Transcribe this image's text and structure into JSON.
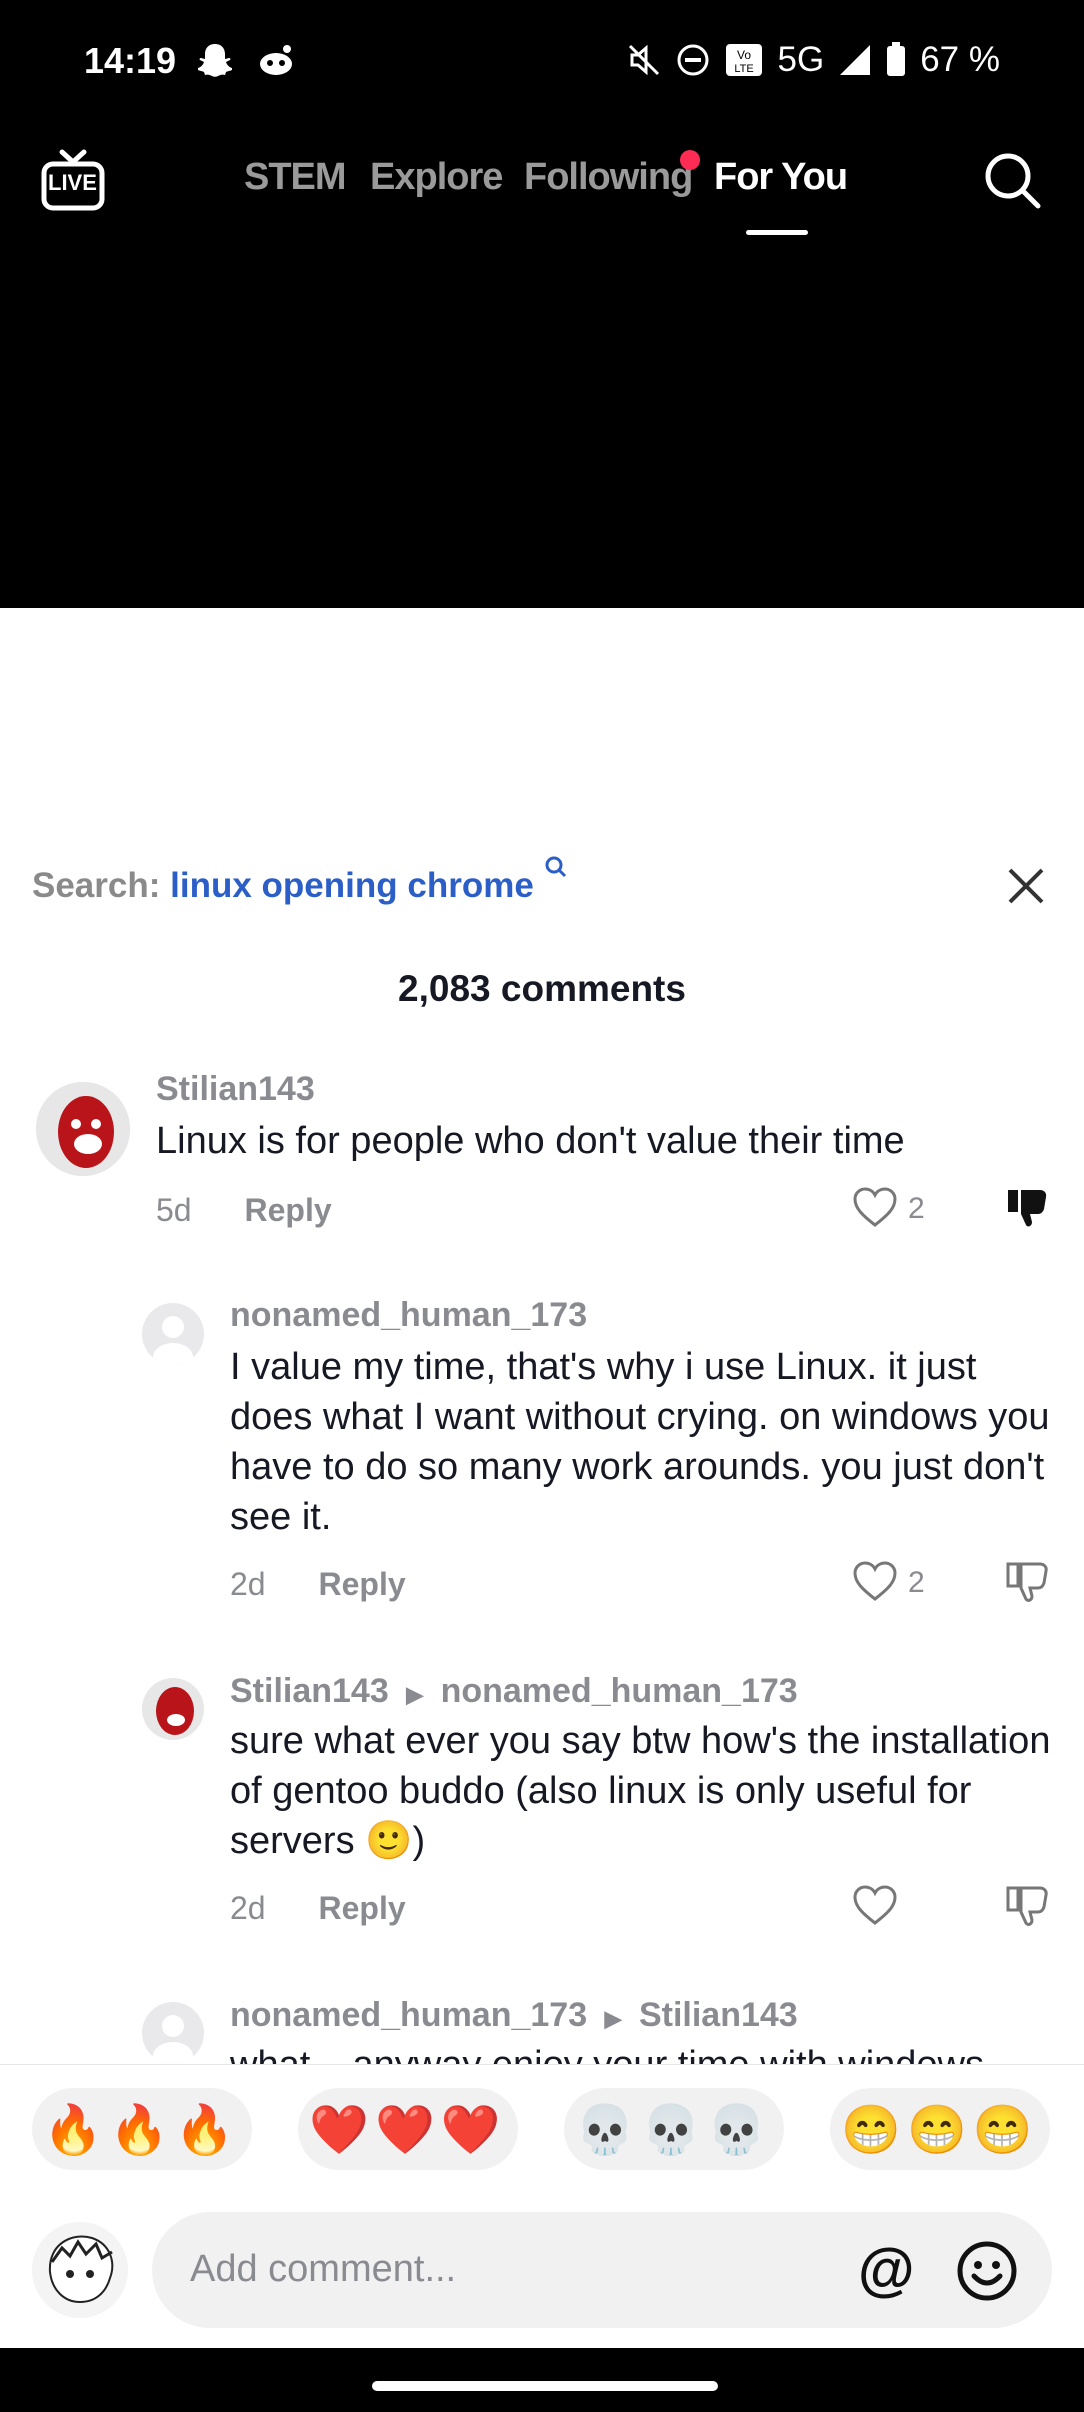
{
  "status": {
    "time": "14:19",
    "network": "5G",
    "battery": "67 %"
  },
  "top_nav": {
    "tabs": [
      "STEM",
      "Explore",
      "Following",
      "For You"
    ],
    "live_label": "LIVE"
  },
  "sheet": {
    "search_label": "Search:",
    "search_query": "linux opening chrome",
    "comments_count": "2,083 comments"
  },
  "comments": [
    {
      "user": "Stilian143",
      "text": "Linux is for people who don't value their time",
      "age": "5d",
      "reply": "Reply",
      "likes": "2"
    },
    {
      "user": "nonamed_human_173",
      "text": "I value my time, that's why i use Linux. it just does what I want without crying. on windows you have to do so many work arounds. you just don't see it.",
      "age": "2d",
      "reply": "Reply",
      "likes": "2"
    },
    {
      "user": "Stilian143",
      "reply_to": "nonamed_human_173",
      "text": "sure what ever you say btw how's the installation of gentoo buddo (also linux is only useful for servers 🙂)",
      "age": "2d",
      "reply": "Reply",
      "likes": ""
    },
    {
      "user": "nonamed_human_173",
      "reply_to": "Stilian143",
      "text": "what... anyway enjoy your time with windows"
    }
  ],
  "quick_reactions": [
    "🔥🔥🔥",
    "❤️❤️❤️",
    "💀💀💀",
    "😁😁😁"
  ],
  "composer": {
    "placeholder": "Add comment...",
    "mention_symbol": "@"
  },
  "colors": {
    "accent": "#fe2c55",
    "link": "#2b5fc7"
  }
}
